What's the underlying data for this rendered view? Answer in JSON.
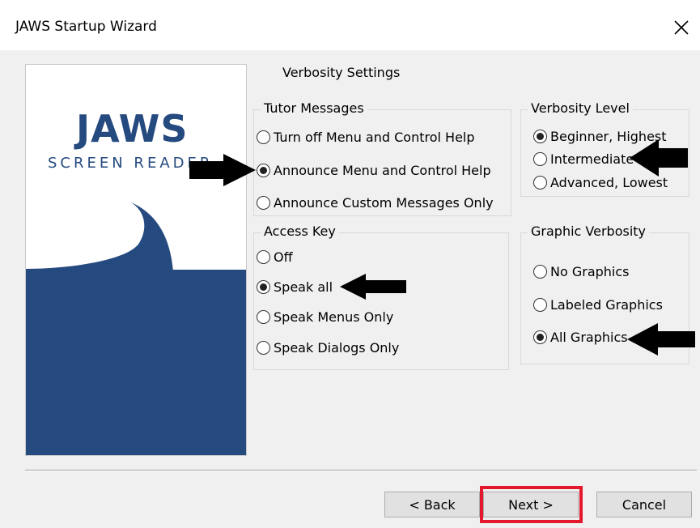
{
  "window": {
    "title": "JAWS Startup Wizard",
    "close_icon": "close-icon"
  },
  "banner": {
    "logo_text": "JAWS",
    "subtitle": "SCREEN READER",
    "colors": {
      "brand_blue": "#254a7f",
      "white": "#ffffff"
    }
  },
  "main": {
    "section_title": "Verbosity Settings"
  },
  "groups": {
    "tutor_messages": {
      "legend": "Tutor Messages",
      "options": [
        {
          "label": "Turn off Menu and Control Help",
          "checked": false
        },
        {
          "label": "Announce Menu and Control Help",
          "checked": true
        },
        {
          "label": "Announce Custom Messages Only",
          "checked": false
        }
      ]
    },
    "verbosity_level": {
      "legend": "Verbosity Level",
      "options": [
        {
          "label": "Beginner, Highest",
          "checked": true
        },
        {
          "label": "Intermediate",
          "checked": false
        },
        {
          "label": "Advanced, Lowest",
          "checked": false
        }
      ]
    },
    "access_key": {
      "legend": "Access Key",
      "options": [
        {
          "label": "Off",
          "checked": false
        },
        {
          "label": "Speak all",
          "checked": true
        },
        {
          "label": "Speak Menus Only",
          "checked": false
        },
        {
          "label": "Speak Dialogs Only",
          "checked": false
        }
      ]
    },
    "graphic_verbosity": {
      "legend": "Graphic Verbosity",
      "options": [
        {
          "label": "No Graphics",
          "checked": false
        },
        {
          "label": "Labeled Graphics",
          "checked": false
        },
        {
          "label": "All Graphics",
          "checked": true
        }
      ]
    }
  },
  "buttons": {
    "back": "< Back",
    "next": "Next >",
    "cancel": "Cancel"
  },
  "annotations": {
    "arrow_color": "#000000",
    "highlight_color": "#e3182a"
  }
}
